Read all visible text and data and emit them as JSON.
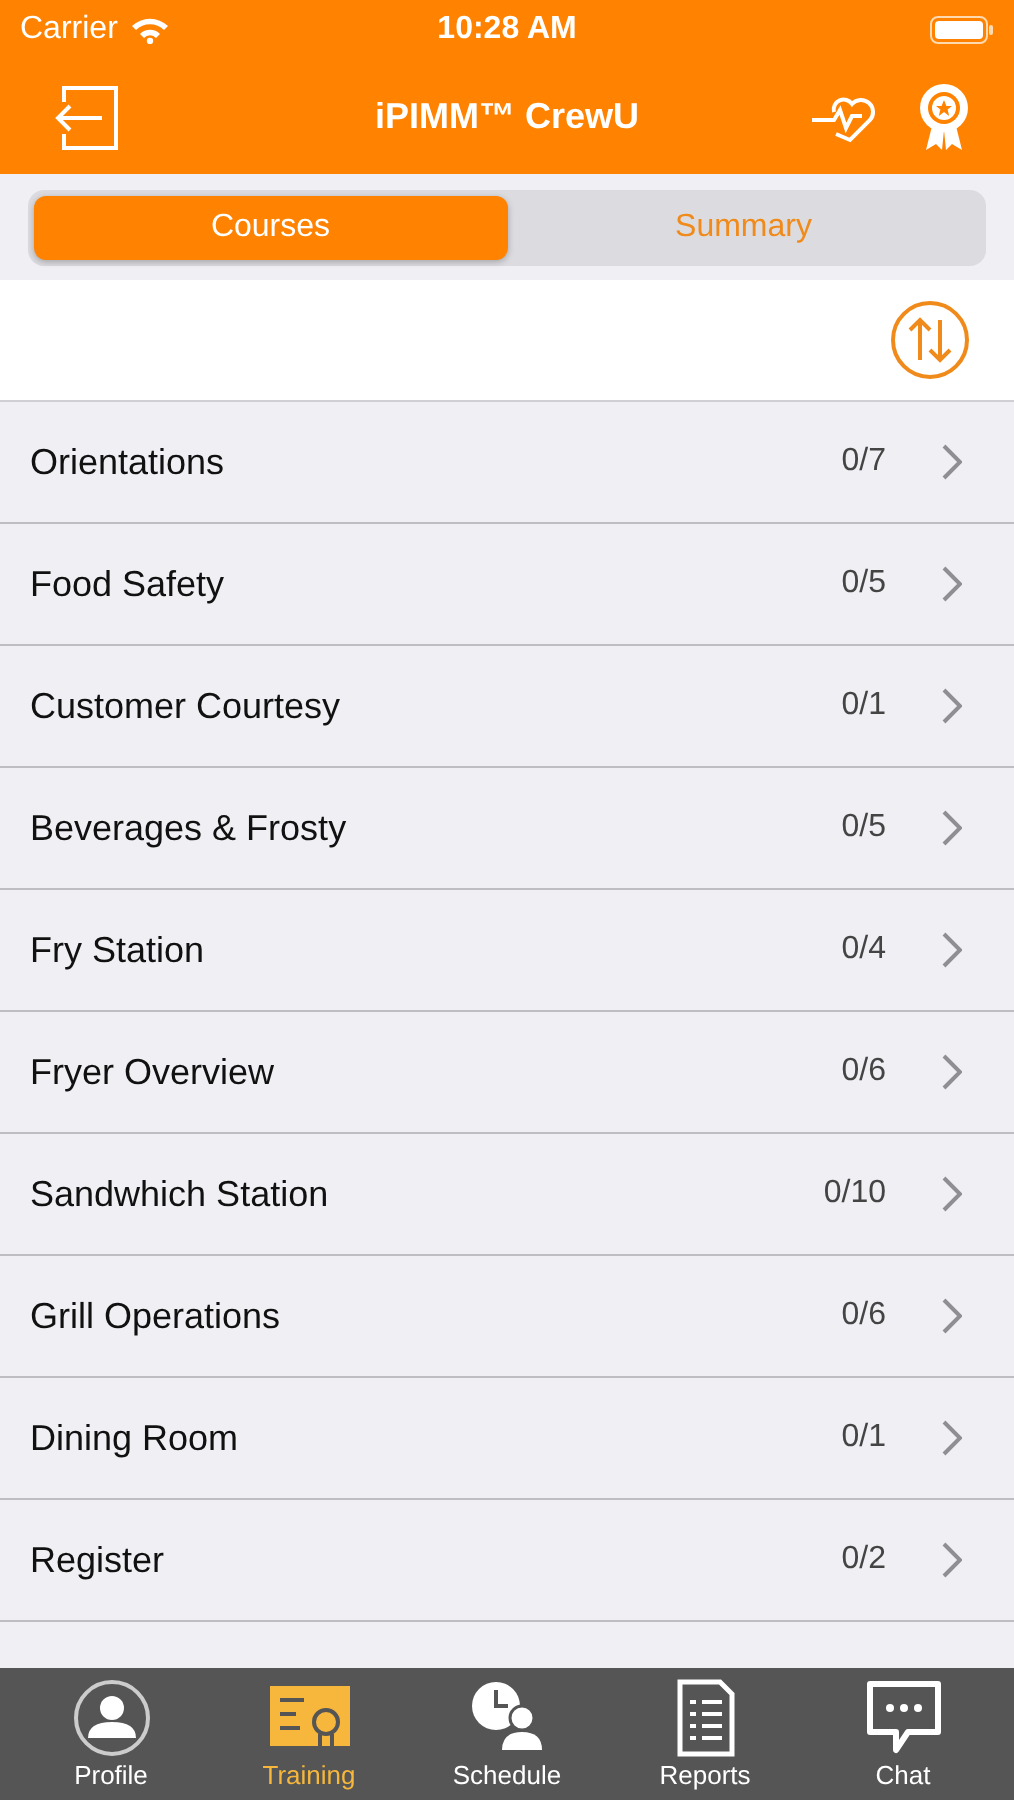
{
  "status_bar": {
    "carrier": "Carrier",
    "time": "10:28 AM"
  },
  "nav": {
    "title": "iPIMM™ CrewU"
  },
  "segments": [
    {
      "label": "Courses",
      "selected": true
    },
    {
      "label": "Summary",
      "selected": false
    }
  ],
  "courses": [
    {
      "name": "Orientations",
      "progress": "0/7"
    },
    {
      "name": "Food Safety",
      "progress": "0/5"
    },
    {
      "name": "Customer Courtesy",
      "progress": "0/1"
    },
    {
      "name": "Beverages & Frosty",
      "progress": "0/5"
    },
    {
      "name": "Fry Station",
      "progress": "0/4"
    },
    {
      "name": "Fryer Overview",
      "progress": "0/6"
    },
    {
      "name": "Sandwhich Station",
      "progress": "0/10"
    },
    {
      "name": "Grill Operations",
      "progress": "0/6"
    },
    {
      "name": "Dining Room",
      "progress": "0/1"
    },
    {
      "name": "Register",
      "progress": "0/2"
    }
  ],
  "tab_bar": [
    {
      "label": "Profile",
      "kind": "profile",
      "selected": false
    },
    {
      "label": "Training",
      "kind": "training",
      "selected": true
    },
    {
      "label": "Schedule",
      "kind": "schedule",
      "selected": false
    },
    {
      "label": "Reports",
      "kind": "reports",
      "selected": false
    },
    {
      "label": "Chat",
      "kind": "chat",
      "selected": false
    }
  ]
}
